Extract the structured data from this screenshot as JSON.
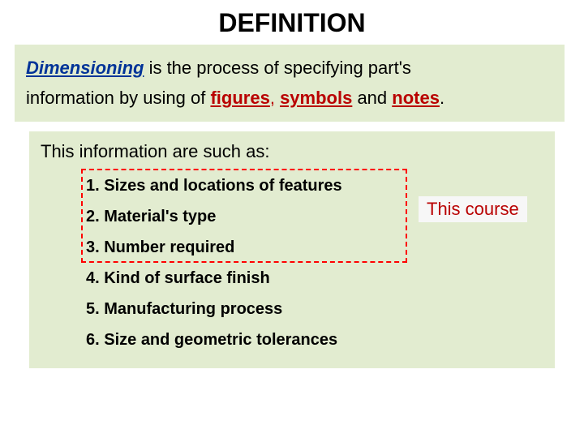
{
  "title": "DEFINITION",
  "para": {
    "word1": "Dimensioning",
    "mid1": " is the process of specifying part's",
    "line2a": "information by using of ",
    "figures": "figures",
    "comma": ", ",
    "symbols": "symbols",
    "and": " and ",
    "notes": "notes",
    "period": "."
  },
  "intro2": "This information are such as:",
  "items": {
    "i1": "1. Sizes and locations of features",
    "i2": "2. Material's type",
    "i3": "3. Number required",
    "i4": "4. Kind of surface finish",
    "i5": "5. Manufacturing process",
    "i6": "6. Size and geometric tolerances"
  },
  "courseLabel": "This course"
}
